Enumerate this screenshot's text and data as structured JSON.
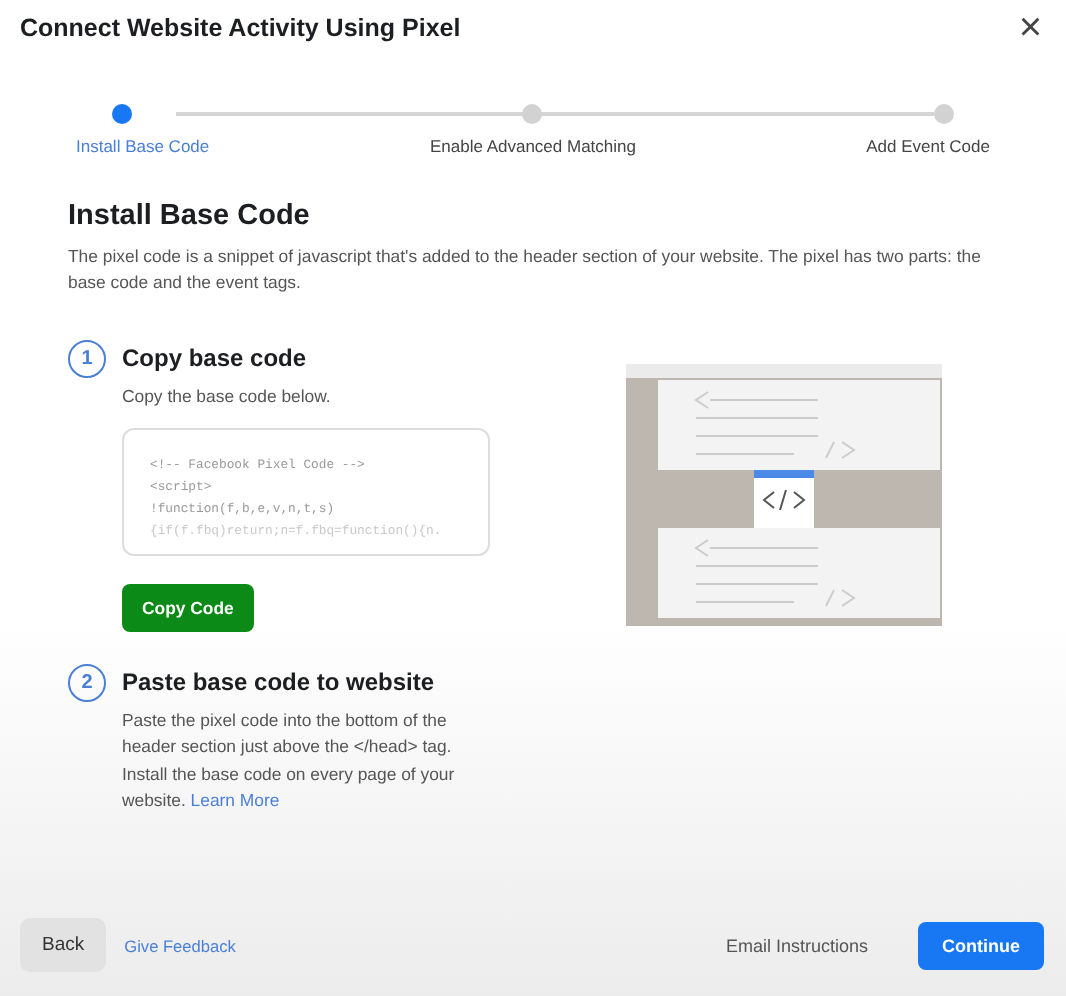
{
  "dialog": {
    "title": "Connect Website Activity Using Pixel",
    "close": "×"
  },
  "steps": [
    {
      "label": "Install Base Code",
      "selected": true
    },
    {
      "label": "Enable Advanced Matching",
      "selected": false
    },
    {
      "label": "Add Event Code",
      "selected": false
    }
  ],
  "section": {
    "title": "Install Base Code",
    "description": "The pixel code is a snippet of javascript that's added to the header section of your website. The pixel has two parts: the base code and the event tags."
  },
  "instructions": [
    {
      "number": "1",
      "title": "Copy base code",
      "text": "Copy the base code below.",
      "code": [
        "<!-- Facebook Pixel Code -->",
        "<script>",
        "!function(f,b,e,v,n,t,s)",
        "{if(f.fbq)return;n=f.fbq=function(){n."
      ],
      "button": "Copy Code"
    },
    {
      "number": "2",
      "title": "Paste base code to website",
      "text": "Paste the pixel code into the bottom of the header section just above the </head> tag. Install the base code on every page of your website.",
      "link": "Learn More"
    }
  ],
  "footer": {
    "back": "Back",
    "feedback": "Give Feedback",
    "email": "Email Instructions",
    "continue": "Continue"
  }
}
